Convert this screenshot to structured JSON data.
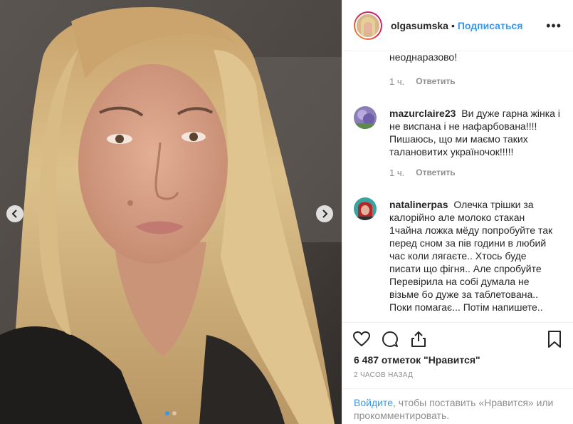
{
  "post": {
    "username": "olgasumska",
    "separator": "•",
    "follow_label": "Подписаться",
    "more_icon": "more-options-icon",
    "carousel": {
      "slide_count": 2,
      "active_index": 0
    }
  },
  "comments": [
    {
      "username": "",
      "text": "неоднаразово!",
      "time": "1 ч.",
      "reply_label": "Ответить"
    },
    {
      "username": "mazurclaire23",
      "text": "Ви дуже гарна жінка і не виспана і не нафарбована!!!! Пишаюсь, що ми маємо таких талановитих україночок!!!!!",
      "time": "1 ч.",
      "reply_label": "Ответить"
    },
    {
      "username": "natalinerpas",
      "text": "Олечка трішки за калорійно але молоко стакан 1чайна ложка мёду попробуйте так перед сном за пів години в любий час коли лягаєте.. Хтось буде писати що фігня.. Але спробуйте Перевірила на собі думала не візьме бо дуже за таблетована.. Поки помагає... Потім напишете..",
      "time": "",
      "reply_label": ""
    }
  ],
  "footer": {
    "likes_text": "6 487 отметок \"Нравится\"",
    "time_ago": "2 ЧАСОВ НАЗАД",
    "login_link": "Войдите",
    "login_rest": ", чтобы поставить «Нравится» или прокомментировать."
  },
  "colors": {
    "accent": "#3897f0",
    "text": "#262626",
    "muted": "#8e8e8e",
    "border": "#efefef"
  }
}
